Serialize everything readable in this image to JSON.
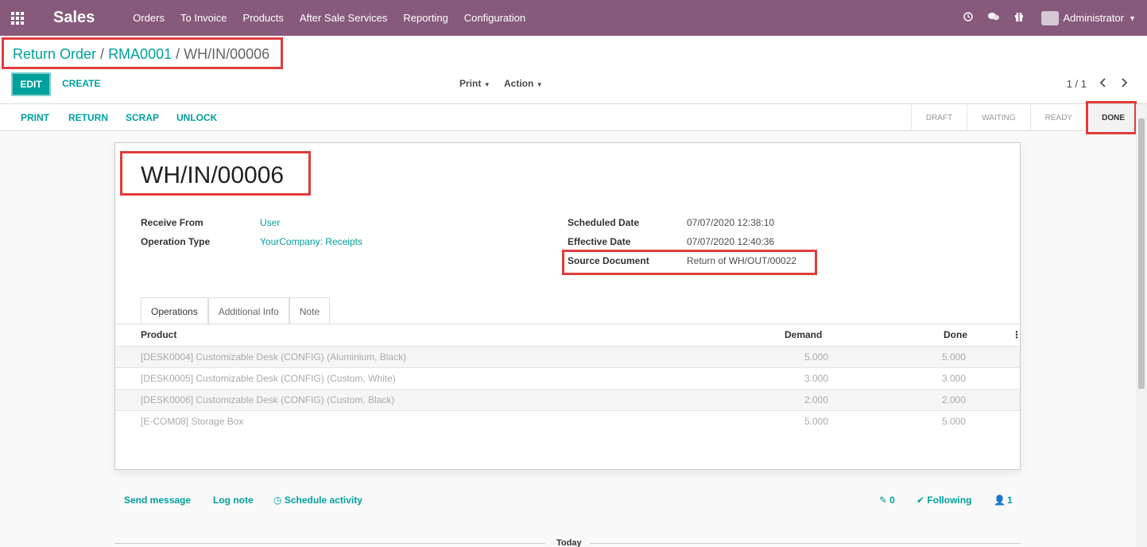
{
  "navbar": {
    "app_name": "Sales",
    "menu": [
      "Orders",
      "To Invoice",
      "Products",
      "After Sale Services",
      "Reporting",
      "Configuration"
    ],
    "user": "Administrator"
  },
  "breadcrumb": {
    "items": [
      "Return Order",
      "RMA0001"
    ],
    "current": "WH/IN/00006"
  },
  "actions": {
    "edit": "EDIT",
    "create": "CREATE",
    "print": "Print",
    "action": "Action",
    "pager": "1 / 1"
  },
  "statusbar": {
    "buttons": [
      "PRINT",
      "RETURN",
      "SCRAP",
      "UNLOCK"
    ],
    "stages": [
      "DRAFT",
      "WAITING",
      "READY",
      "DONE"
    ],
    "current_stage": "DONE"
  },
  "form": {
    "title": "WH/IN/00006",
    "receive_from_label": "Receive From",
    "receive_from": "User",
    "operation_type_label": "Operation Type",
    "operation_type": "YourCompany: Receipts",
    "scheduled_date_label": "Scheduled Date",
    "scheduled_date": "07/07/2020 12:38:10",
    "effective_date_label": "Effective Date",
    "effective_date": "07/07/2020 12:40:36",
    "source_document_label": "Source Document",
    "source_document": "Return of WH/OUT/00022"
  },
  "tabs": [
    "Operations",
    "Additional Info",
    "Note"
  ],
  "table": {
    "headers": [
      "Product",
      "Demand",
      "Done"
    ],
    "rows": [
      [
        "[DESK0004] Customizable Desk (CONFIG) (Aluminium, Black)",
        "5.000",
        "5.000"
      ],
      [
        "[DESK0005] Customizable Desk (CONFIG) (Custom, White)",
        "3.000",
        "3.000"
      ],
      [
        "[DESK0006] Customizable Desk (CONFIG) (Custom, Black)",
        "2.000",
        "2.000"
      ],
      [
        "[E-COM08] Storage Box",
        "5.000",
        "5.000"
      ]
    ]
  },
  "chatter": {
    "send_message": "Send message",
    "log_note": "Log note",
    "schedule_activity": "Schedule activity",
    "attachments": "0",
    "following": "Following",
    "followers": "1",
    "today": "Today"
  },
  "colors": {
    "brand": "#875a7b",
    "accent": "#00a09d",
    "highlight": "#e03c3c"
  }
}
